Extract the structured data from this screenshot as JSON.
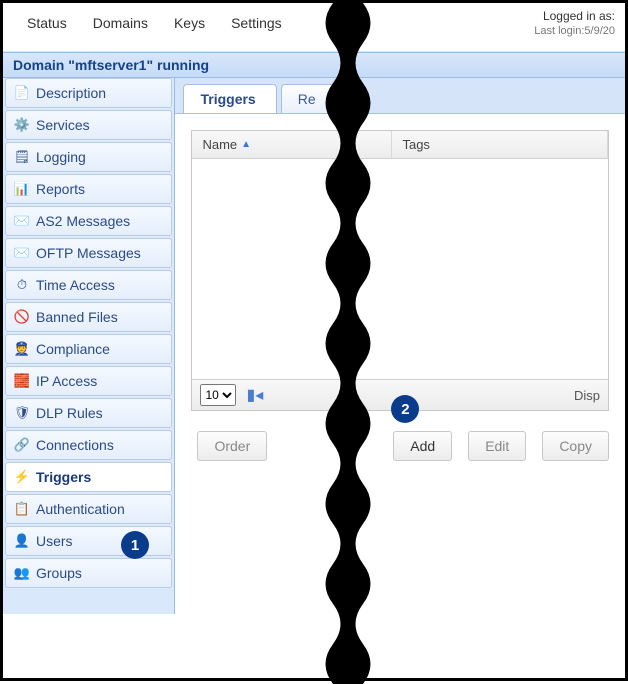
{
  "topnav": {
    "status": "Status",
    "domains": "Domains",
    "keys": "Keys",
    "settings": "Settings"
  },
  "login": {
    "label": "Logged in as:",
    "last_prefix": "Last login:",
    "last_value": "5/9/20"
  },
  "domain_title": "Domain \"mftserver1\" running",
  "sidebar": {
    "items": [
      {
        "label": "Description",
        "icon": "📄",
        "name": "sidebar-description"
      },
      {
        "label": "Services",
        "icon": "⚙️",
        "name": "sidebar-services"
      },
      {
        "label": "Logging",
        "icon": "🗒",
        "name": "sidebar-logging"
      },
      {
        "label": "Reports",
        "icon": "📊",
        "name": "sidebar-reports"
      },
      {
        "label": "AS2 Messages",
        "icon": "✉️",
        "name": "sidebar-as2-messages"
      },
      {
        "label": "OFTP Messages",
        "icon": "✉️",
        "name": "sidebar-oftp-messages"
      },
      {
        "label": "Time Access",
        "icon": "⏱",
        "name": "sidebar-time-access"
      },
      {
        "label": "Banned Files",
        "icon": "🚫",
        "name": "sidebar-banned-files"
      },
      {
        "label": "Compliance",
        "icon": "👮",
        "name": "sidebar-compliance"
      },
      {
        "label": "IP Access",
        "icon": "🧱",
        "name": "sidebar-ip-access"
      },
      {
        "label": "DLP Rules",
        "icon": "🛡",
        "name": "sidebar-dlp-rules"
      },
      {
        "label": "Connections",
        "icon": "🔗",
        "name": "sidebar-connections"
      },
      {
        "label": "Triggers",
        "icon": "⚡",
        "name": "sidebar-triggers",
        "active": true
      },
      {
        "label": "Authentication",
        "icon": "📋",
        "name": "sidebar-authentication"
      },
      {
        "label": "Users",
        "icon": "👤",
        "name": "sidebar-users"
      },
      {
        "label": "Groups",
        "icon": "👥",
        "name": "sidebar-groups"
      }
    ]
  },
  "tabs": {
    "triggers": "Triggers",
    "other_partial": "Re"
  },
  "grid": {
    "columns": {
      "name": "Name",
      "tags": "Tags"
    },
    "page_size": "10",
    "display_partial": "Disp"
  },
  "buttons": {
    "order": "Order",
    "add": "Add",
    "edit": "Edit",
    "copy": "Copy"
  },
  "callouts": {
    "one": "1",
    "two": "2"
  }
}
